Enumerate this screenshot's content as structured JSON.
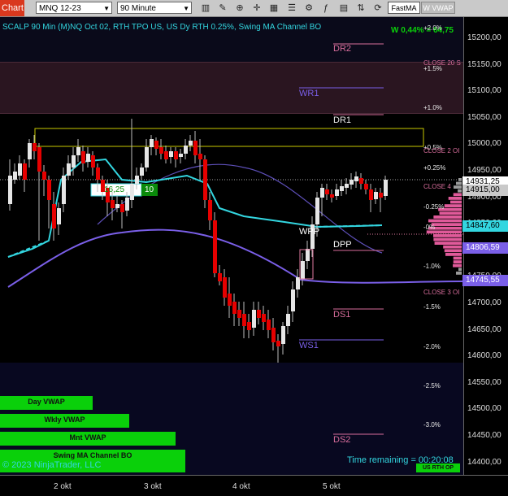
{
  "toolbar": {
    "tab_label": "Chart",
    "instrument": "MNQ 12-23",
    "interval": "90 Minute",
    "style_preset": "FastMA",
    "vwap_button": "W VWAP",
    "icons": [
      "bar-style-icon",
      "draw-tools-icon",
      "zoom-icon",
      "crosshair-icon",
      "data-box-icon",
      "properties-icon",
      "strategies-icon",
      "indicators-icon",
      "templates-icon",
      "ticker-icon"
    ]
  },
  "chart": {
    "title": "SCALP 90 Min (M)NQ Oct 02, RTH TPO US, US Dy RTH 0.25%, Swing MA Channel BO",
    "pnl": "W 0,44% = 64,75",
    "box_value": "16,25",
    "box_count": "10",
    "copyright": "© 2023 NinjaTrader, LLC",
    "time_remaining": "Time remaining = 00:20:08",
    "session_badge": "US RTH OP",
    "levels": [
      "DR2",
      "WR1",
      "DR1",
      "WPP",
      "DPP",
      "DS1",
      "WS1",
      "DS2"
    ],
    "percent_labels": [
      "+2.0%",
      "+1.5%",
      "+1.0%",
      "+0.5%",
      "+0.25%",
      "-0.25%",
      "-0%",
      "-1.0%",
      "-1.5%",
      "-2.0%",
      "-2.5%",
      "-3.0%"
    ],
    "close_labels": [
      "CLOSE 20 S",
      "CLOSE 2 OI",
      "CLOSE 4",
      "CLOSE 3 OI"
    ],
    "vwap_bars": [
      "Day VWAP",
      "Wkly VWAP",
      "Mnt VWAP",
      "Swing MA Channel BO"
    ],
    "colors": {
      "up": "#e6e6e6",
      "down": "#e60000",
      "cyan": "#33d6e0",
      "purple": "#7a5fe8",
      "green": "#0ad00a"
    }
  },
  "price_axis": {
    "ticks": [
      "15200,00",
      "15150,00",
      "15100,00",
      "15050,00",
      "15000,00",
      "14950,00",
      "14900,00",
      "14850,00",
      "14800,00",
      "14750,00",
      "14700,00",
      "14650,00",
      "14600,00",
      "14550,00",
      "14500,00",
      "14450,00",
      "14400,00"
    ],
    "tags": [
      {
        "value": "14931,25",
        "bg": "#ffffff",
        "fg": "#000000"
      },
      {
        "value": "14915,00",
        "bg": "#c9c9c9",
        "fg": "#000000"
      },
      {
        "value": "14847,60",
        "bg": "#33d6e0",
        "fg": "#000000"
      },
      {
        "value": "14806,59",
        "bg": "#7a5fe8",
        "fg": "#ffffff"
      },
      {
        "value": "14745,55",
        "bg": "#7a5fe8",
        "fg": "#ffffff"
      }
    ]
  },
  "time_axis": {
    "ticks": [
      "2 okt",
      "3 okt",
      "4 okt",
      "5 okt"
    ]
  }
}
